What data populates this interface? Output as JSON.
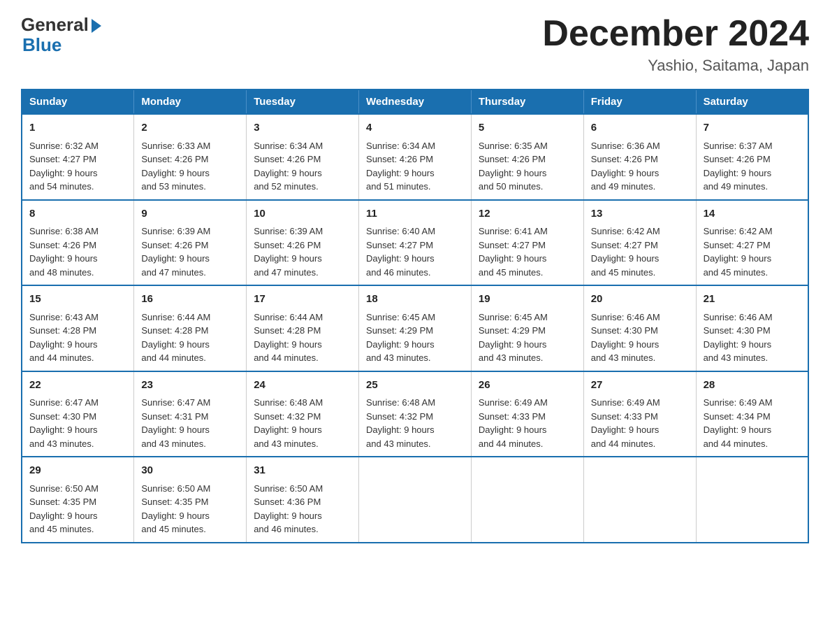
{
  "logo": {
    "general": "General",
    "blue": "Blue"
  },
  "title": "December 2024",
  "location": "Yashio, Saitama, Japan",
  "days_of_week": [
    "Sunday",
    "Monday",
    "Tuesday",
    "Wednesday",
    "Thursday",
    "Friday",
    "Saturday"
  ],
  "weeks": [
    [
      {
        "day": "1",
        "sunrise": "6:32 AM",
        "sunset": "4:27 PM",
        "daylight": "9 hours and 54 minutes."
      },
      {
        "day": "2",
        "sunrise": "6:33 AM",
        "sunset": "4:26 PM",
        "daylight": "9 hours and 53 minutes."
      },
      {
        "day": "3",
        "sunrise": "6:34 AM",
        "sunset": "4:26 PM",
        "daylight": "9 hours and 52 minutes."
      },
      {
        "day": "4",
        "sunrise": "6:34 AM",
        "sunset": "4:26 PM",
        "daylight": "9 hours and 51 minutes."
      },
      {
        "day": "5",
        "sunrise": "6:35 AM",
        "sunset": "4:26 PM",
        "daylight": "9 hours and 50 minutes."
      },
      {
        "day": "6",
        "sunrise": "6:36 AM",
        "sunset": "4:26 PM",
        "daylight": "9 hours and 49 minutes."
      },
      {
        "day": "7",
        "sunrise": "6:37 AM",
        "sunset": "4:26 PM",
        "daylight": "9 hours and 49 minutes."
      }
    ],
    [
      {
        "day": "8",
        "sunrise": "6:38 AM",
        "sunset": "4:26 PM",
        "daylight": "9 hours and 48 minutes."
      },
      {
        "day": "9",
        "sunrise": "6:39 AM",
        "sunset": "4:26 PM",
        "daylight": "9 hours and 47 minutes."
      },
      {
        "day": "10",
        "sunrise": "6:39 AM",
        "sunset": "4:26 PM",
        "daylight": "9 hours and 47 minutes."
      },
      {
        "day": "11",
        "sunrise": "6:40 AM",
        "sunset": "4:27 PM",
        "daylight": "9 hours and 46 minutes."
      },
      {
        "day": "12",
        "sunrise": "6:41 AM",
        "sunset": "4:27 PM",
        "daylight": "9 hours and 45 minutes."
      },
      {
        "day": "13",
        "sunrise": "6:42 AM",
        "sunset": "4:27 PM",
        "daylight": "9 hours and 45 minutes."
      },
      {
        "day": "14",
        "sunrise": "6:42 AM",
        "sunset": "4:27 PM",
        "daylight": "9 hours and 45 minutes."
      }
    ],
    [
      {
        "day": "15",
        "sunrise": "6:43 AM",
        "sunset": "4:28 PM",
        "daylight": "9 hours and 44 minutes."
      },
      {
        "day": "16",
        "sunrise": "6:44 AM",
        "sunset": "4:28 PM",
        "daylight": "9 hours and 44 minutes."
      },
      {
        "day": "17",
        "sunrise": "6:44 AM",
        "sunset": "4:28 PM",
        "daylight": "9 hours and 44 minutes."
      },
      {
        "day": "18",
        "sunrise": "6:45 AM",
        "sunset": "4:29 PM",
        "daylight": "9 hours and 43 minutes."
      },
      {
        "day": "19",
        "sunrise": "6:45 AM",
        "sunset": "4:29 PM",
        "daylight": "9 hours and 43 minutes."
      },
      {
        "day": "20",
        "sunrise": "6:46 AM",
        "sunset": "4:30 PM",
        "daylight": "9 hours and 43 minutes."
      },
      {
        "day": "21",
        "sunrise": "6:46 AM",
        "sunset": "4:30 PM",
        "daylight": "9 hours and 43 minutes."
      }
    ],
    [
      {
        "day": "22",
        "sunrise": "6:47 AM",
        "sunset": "4:30 PM",
        "daylight": "9 hours and 43 minutes."
      },
      {
        "day": "23",
        "sunrise": "6:47 AM",
        "sunset": "4:31 PM",
        "daylight": "9 hours and 43 minutes."
      },
      {
        "day": "24",
        "sunrise": "6:48 AM",
        "sunset": "4:32 PM",
        "daylight": "9 hours and 43 minutes."
      },
      {
        "day": "25",
        "sunrise": "6:48 AM",
        "sunset": "4:32 PM",
        "daylight": "9 hours and 43 minutes."
      },
      {
        "day": "26",
        "sunrise": "6:49 AM",
        "sunset": "4:33 PM",
        "daylight": "9 hours and 44 minutes."
      },
      {
        "day": "27",
        "sunrise": "6:49 AM",
        "sunset": "4:33 PM",
        "daylight": "9 hours and 44 minutes."
      },
      {
        "day": "28",
        "sunrise": "6:49 AM",
        "sunset": "4:34 PM",
        "daylight": "9 hours and 44 minutes."
      }
    ],
    [
      {
        "day": "29",
        "sunrise": "6:50 AM",
        "sunset": "4:35 PM",
        "daylight": "9 hours and 45 minutes."
      },
      {
        "day": "30",
        "sunrise": "6:50 AM",
        "sunset": "4:35 PM",
        "daylight": "9 hours and 45 minutes."
      },
      {
        "day": "31",
        "sunrise": "6:50 AM",
        "sunset": "4:36 PM",
        "daylight": "9 hours and 46 minutes."
      },
      null,
      null,
      null,
      null
    ]
  ],
  "labels": {
    "sunrise": "Sunrise:",
    "sunset": "Sunset:",
    "daylight": "Daylight:"
  }
}
